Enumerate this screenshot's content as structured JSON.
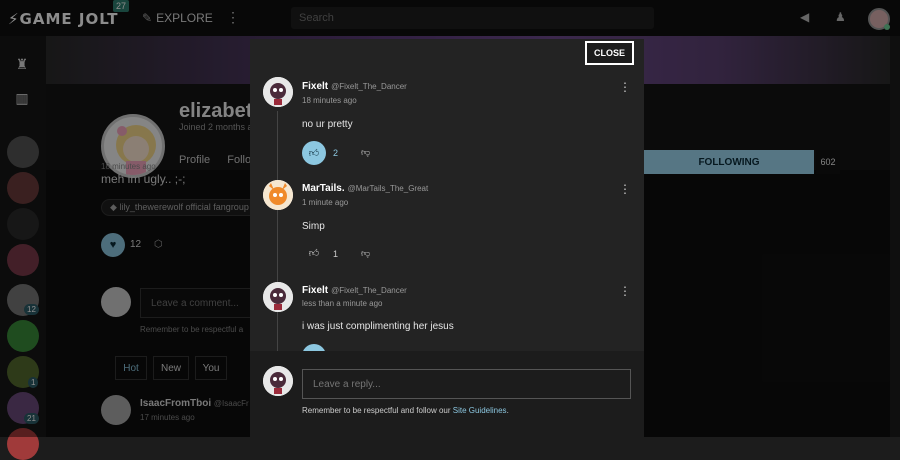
{
  "topbar": {
    "logo": "GAME JOLT",
    "logo_badge": "27",
    "explore_label": "EXPLORE",
    "search_placeholder": "Search"
  },
  "leftbar": {
    "counts": [
      "12",
      "1",
      "21"
    ]
  },
  "profile": {
    "name": "elizabetl",
    "joined": "Joined 2 months a",
    "tabs": [
      "Profile",
      "Follo"
    ],
    "following_label": "FOLLOWING",
    "following_count": "602"
  },
  "post": {
    "time": "18 minutes ago",
    "text": "meh im ugly.. ;-;",
    "tag": "lily_thewerewolf official fangroup",
    "like_count": "12",
    "comment_placeholder": "Leave a comment...",
    "respect_text": "Remember to be respectful a",
    "sort_tabs": [
      "Hot",
      "New",
      "You"
    ],
    "bottom_commenter": {
      "name": "IsaacFromTboi",
      "handle": "@IsaacFr",
      "time": "17 minutes ago"
    }
  },
  "modal": {
    "close_label": "CLOSE",
    "comments": [
      {
        "name": "Fixelt",
        "handle": "@Fixelt_The_Dancer",
        "time": "18 minutes ago",
        "text": "no ur pretty",
        "votes": "2"
      },
      {
        "name": "MarTails.",
        "handle": "@MarTails_The_Great",
        "time": "1 minute ago",
        "text": "Simp",
        "votes": "1"
      },
      {
        "name": "Fixelt",
        "handle": "@Fixelt_The_Dancer",
        "time": "less than a minute ago",
        "text": "i was just complimenting her jesus",
        "votes": ""
      }
    ],
    "reply_placeholder": "Leave a reply...",
    "reply_note_prefix": "Remember to be respectful and follow our ",
    "reply_note_link": "Site Guidelines",
    "reply_note_suffix": "."
  },
  "colors": {
    "accent": "#8cc7e0",
    "modal_bg": "#232323",
    "page_bg": "#0e0e0e"
  }
}
